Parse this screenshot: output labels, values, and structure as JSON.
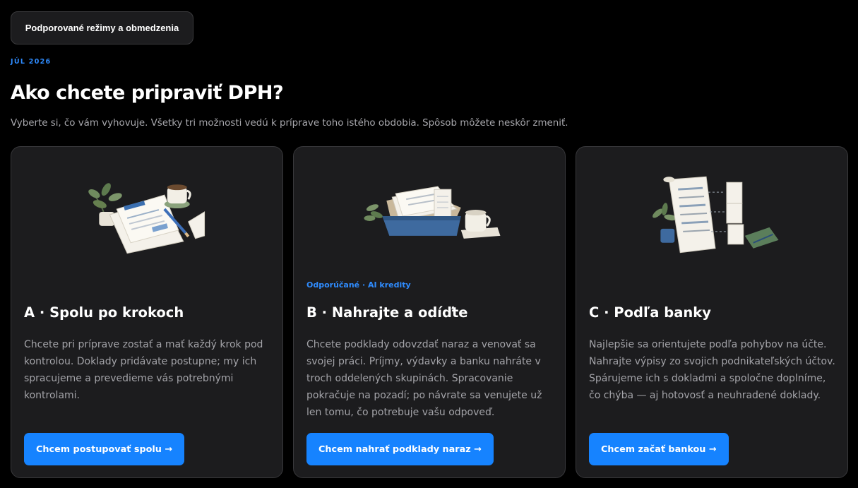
{
  "header": {
    "modes_button": "Podporované režimy a obmedzenia",
    "period": "JÚL 2026",
    "title": "Ako chcete pripraviť DPH?",
    "subtitle": "Vyberte si, čo vám vyhovuje. Všetky tri možnosti vedú k príprave toho istého obdobia. Spôsob môžete neskôr zmeniť."
  },
  "cards": [
    {
      "badge": "",
      "title": "A · Spolu po krokoch",
      "description": "Chcete pri príprave zostať a mať každý krok pod kontrolou. Doklady pridávate postupne; my ich spracujeme a prevedieme vás potrebnými kontrolami.",
      "cta": "Chcem postupovať spolu →"
    },
    {
      "badge": "Odporúčané · AI kredity",
      "title": "B · Nahrajte a odíďte",
      "description": "Chcete podklady odovzdať naraz a venovať sa svojej práci. Príjmy, výdavky a banku nahráte v troch oddelených skupinách. Spracovanie pokračuje na pozadí; po návrate sa venujete už len tomu, čo potrebuje vašu odpoveď.",
      "cta": "Chcem nahrať podklady naraz →"
    },
    {
      "badge": "",
      "title": "C · Podľa banky",
      "description": "Najlepšie sa orientujete podľa pohybov na účte. Nahrajte výpisy zo svojich podnikateľských účtov. Spárujeme ich s dokladmi a spoločne doplníme, čo chýba — aj hotovosť a neuhradené doklady.",
      "cta": "Chcem začať bankou →"
    }
  ],
  "colors": {
    "accent": "#1683ff",
    "background": "#000000",
    "card": "#1c1c1e"
  }
}
